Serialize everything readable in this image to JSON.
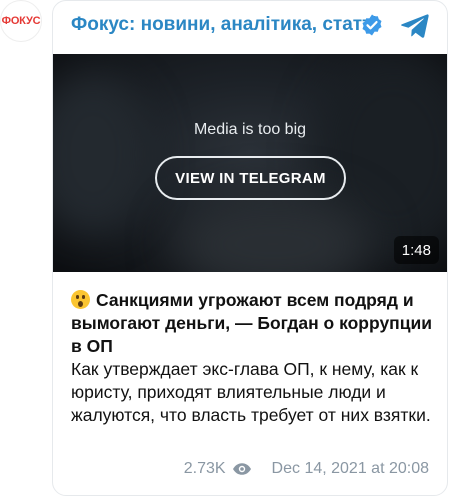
{
  "avatar": {
    "text": "ФОКУС"
  },
  "header": {
    "channel_name": "Фокус: новини, аналітика, статті"
  },
  "media": {
    "message": "Media is too big",
    "button_label": "VIEW IN TELEGRAM",
    "duration": "1:48"
  },
  "post": {
    "title": "Санкциями угрожают всем подряд и вымогают деньги, — Богдан о коррупции в ОП",
    "body": "Как утверждает экс-глава ОП, к нему, как к юристу, приходят влиятельные люди и жалуются, что власть требует от них взятки."
  },
  "meta": {
    "views": "2.73K",
    "date": "Dec 14, 2021 at 20:08"
  },
  "colors": {
    "accent": "#2b87c4",
    "meta": "#8a97a3",
    "verified": "#3d9ae8"
  }
}
